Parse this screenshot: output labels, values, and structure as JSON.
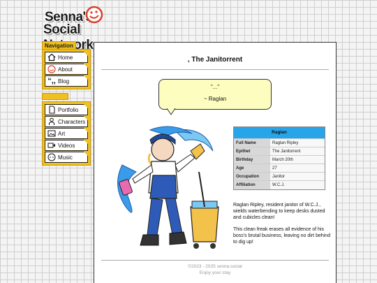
{
  "logo": {
    "line1": "Senna's",
    "line2": "Social Network"
  },
  "nav": {
    "tab_label": "Navigation",
    "group1": [
      {
        "label": "Home",
        "icon": "home-icon"
      },
      {
        "label": "About",
        "icon": "smiley-icon"
      },
      {
        "label": "Blog",
        "icon": "quote-icon"
      }
    ],
    "group2": [
      {
        "label": "Portfolio",
        "icon": "document-icon"
      },
      {
        "label": "Characters",
        "icon": "person-icon"
      },
      {
        "label": "Art",
        "icon": "picture-icon"
      },
      {
        "label": "Videos",
        "icon": "video-icon"
      },
      {
        "label": "Music",
        "icon": "music-icon"
      }
    ]
  },
  "page": {
    "title": ", The Janitorrent",
    "quote_line1": "\"...\"",
    "quote_line2": "~ Raglan"
  },
  "infobox": {
    "header": "Raglan",
    "rows": [
      {
        "key": "Full Name",
        "value": "Raglan Ripley"
      },
      {
        "key": "Epithet",
        "value": "The Janitorrent"
      },
      {
        "key": "Birthday",
        "value": "March 20th"
      },
      {
        "key": "Age",
        "value": "27"
      },
      {
        "key": "Occupation",
        "value": "Janitor"
      },
      {
        "key": "Affiliation",
        "value": "W.C.J."
      }
    ]
  },
  "description": {
    "p1": "Raglan Ripley, resident janitor of W.C.J., wields waterbending to keep desks dusted and cubicles clean!",
    "p2": "This clean freak erases all evidence of his boss's brutal business, leaving no dirt behind to dig up!"
  },
  "footer": {
    "line1": "©2023 - 2025 senna.social",
    "line2": "Enjoy your stay"
  },
  "colors": {
    "accent": "#f0c020",
    "infobox_header": "#28a4e8",
    "bubble": "#fdfdc0"
  }
}
